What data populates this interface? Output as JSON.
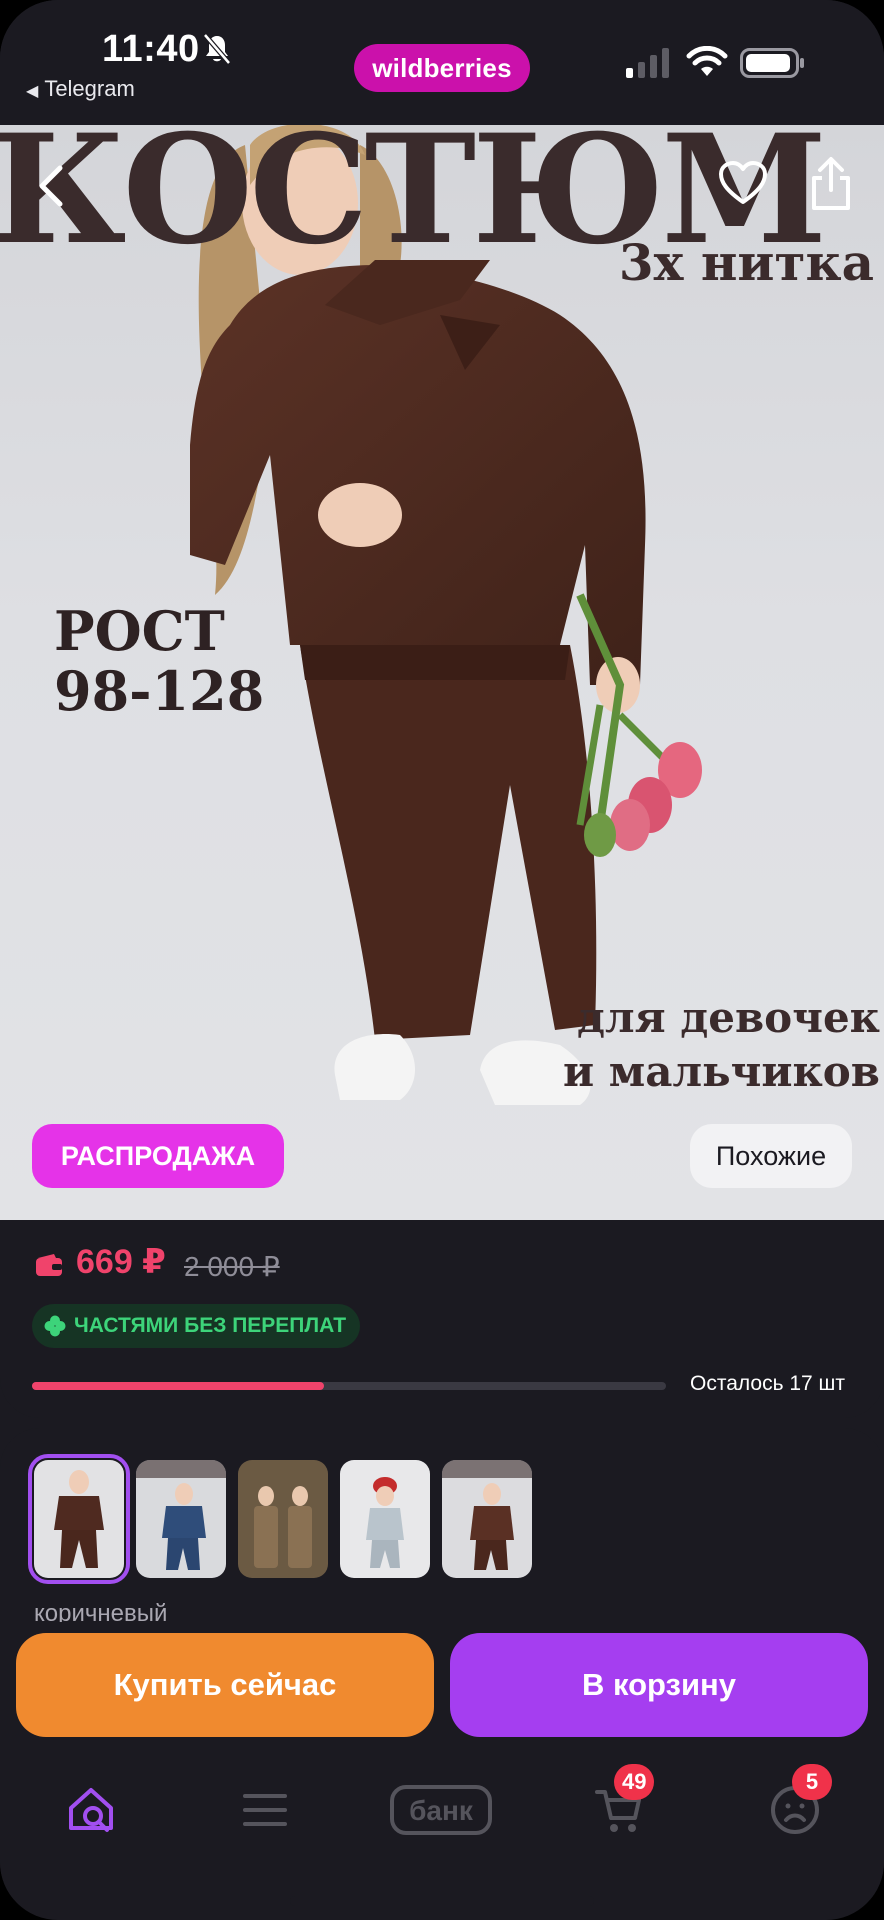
{
  "status_bar": {
    "time": "11:40",
    "back_app": "Telegram",
    "brand": "wildberries"
  },
  "hero": {
    "title": "КОСТЮМ",
    "subtitle": "3х нитка",
    "height_line1": "РОСТ",
    "height_line2": "98-128",
    "for_line1": "для девочек",
    "for_line2": "и мальчиков",
    "sale_label": "РАСПРОДАЖА",
    "similar_label": "Похожие"
  },
  "price": {
    "current": "669 ₽",
    "old": "2 000 ₽",
    "installment": "ЧАСТЯМИ БЕЗ ПЕРЕПЛАТ",
    "stock_text": "Осталось 17 шт",
    "stock_fraction": 0.46
  },
  "variants": {
    "color_label": "коричневый",
    "thumbnails": [
      "thumb-1",
      "thumb-2",
      "thumb-3",
      "thumb-4",
      "thumb-5"
    ],
    "selected_index": 0
  },
  "actions": {
    "buy_now": "Купить сейчас",
    "add_to_cart": "В корзину"
  },
  "tabbar": {
    "bank_label": "банк",
    "cart_badge": "49",
    "profile_badge": "5"
  },
  "colors": {
    "brand": "#cb11ab",
    "price": "#f0436b",
    "buy_now": "#f08a2f",
    "add_to_cart": "#a53ef0",
    "sale_badge": "#e533e8",
    "installment_text": "#3dd47a",
    "active_tab": "#a24ff0"
  }
}
